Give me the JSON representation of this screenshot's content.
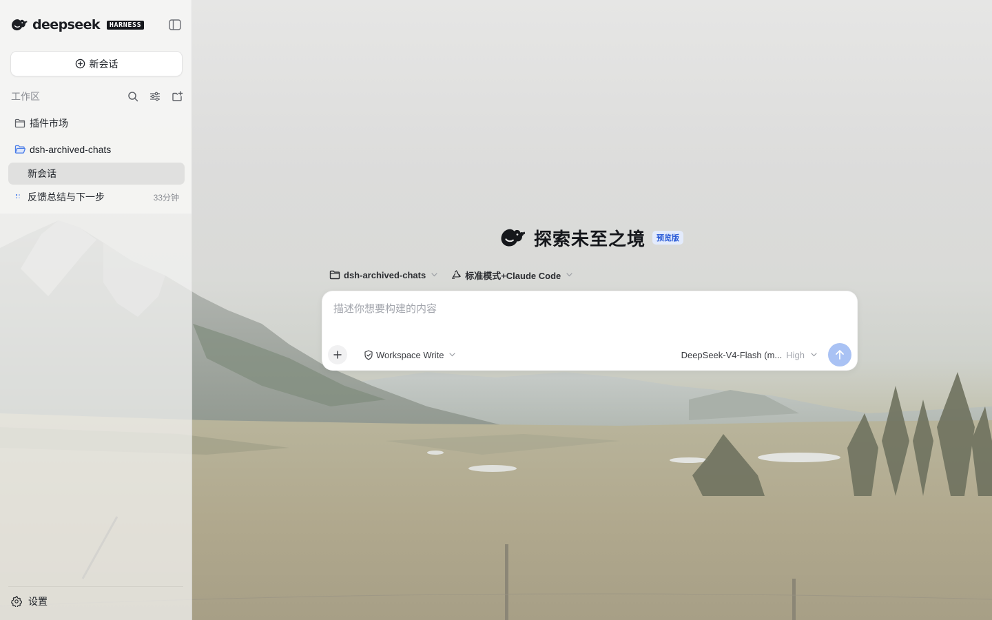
{
  "brand": {
    "name": "deepseek",
    "badge": "HARNESS"
  },
  "sidebar": {
    "new_chat_label": "新会话",
    "workspace_label": "工作区",
    "tree": {
      "plugins_label": "插件市场",
      "folder_label": "dsh-archived-chats",
      "chats": [
        {
          "title": "新会话",
          "time": ""
        },
        {
          "title": "反馈总结与下一步",
          "time": "33分钟"
        }
      ]
    },
    "settings_label": "设置"
  },
  "hero": {
    "title": "探索未至之境",
    "badge": "预览版"
  },
  "context": {
    "folder": "dsh-archived-chats",
    "mode": "标准模式+Claude Code"
  },
  "composer": {
    "placeholder": "描述你想要构建的内容",
    "value": "",
    "permission": "Workspace Write",
    "model": "DeepSeek-V4-Flash (m...",
    "effort": "High"
  },
  "colors": {
    "accent": "#2a5bd7",
    "send_disabled": "#a9c2f4",
    "badge_bg": "#e3ebfc",
    "folder_icon": "#4a7de8"
  },
  "icons": {
    "brand": "whale-logo-icon",
    "toggle": "sidebar-toggle-icon",
    "new_chat": "plus-circle-icon",
    "search": "search-icon",
    "filter": "sliders-icon",
    "new_folder": "folder-plus-icon",
    "plugins": "folder-icon",
    "workspace_folder": "folder-open-icon",
    "settings": "gear-icon",
    "send": "arrow-up-icon"
  }
}
